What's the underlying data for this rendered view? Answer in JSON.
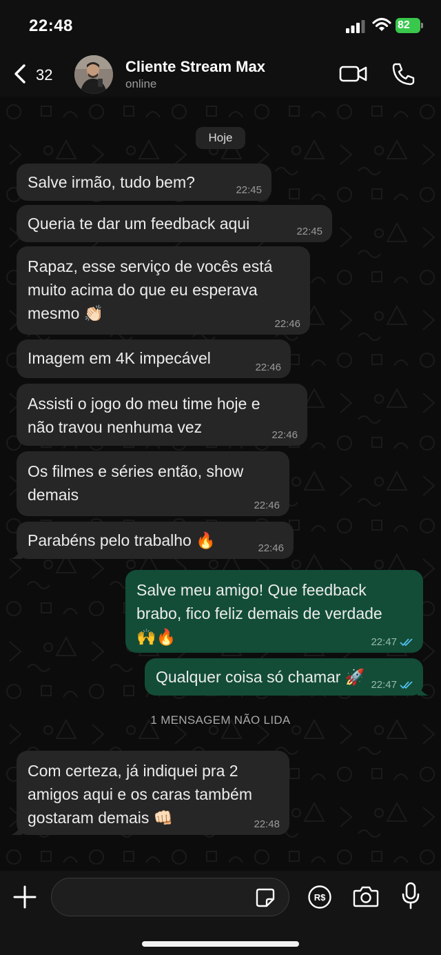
{
  "status_bar": {
    "time": "22:48",
    "battery": "82"
  },
  "header": {
    "back_count": "32",
    "contact_name": "Cliente Stream Max",
    "contact_status": "online"
  },
  "date_label": "Hoje",
  "messages": [
    {
      "direction": "in",
      "text": "Salve irmão, tudo bem?",
      "time": "22:45"
    },
    {
      "direction": "in",
      "text": "Queria te dar um feedback aqui",
      "time": "22:45"
    },
    {
      "direction": "in",
      "text": "Rapaz, esse serviço de vocês está\nmuito acima do que eu esperava\nmesmo 👏🏻",
      "time": "22:46"
    },
    {
      "direction": "in",
      "text": "Imagem em 4K impecável",
      "time": "22:46"
    },
    {
      "direction": "in",
      "text": "Assisti o jogo do meu time hoje e\nnão travou nenhuma vez",
      "time": "22:46"
    },
    {
      "direction": "in",
      "text": "Os filmes e séries então, show\ndemais",
      "time": "22:46"
    },
    {
      "direction": "in",
      "text": "Parabéns pelo trabalho 🔥",
      "time": "22:46"
    },
    {
      "direction": "out",
      "text": "Salve meu amigo! Que feedback\nbrabo, fico feliz demais de verdade\n🙌🔥",
      "time": "22:47",
      "read": true
    },
    {
      "direction": "out",
      "text": "Qualquer coisa só chamar 🚀",
      "time": "22:47",
      "read": true
    },
    {
      "direction": "in",
      "text": "Com certeza, já indiquei pra 2\namigos aqui e os caras também\ngostaram demais 👊🏻",
      "time": "22:48"
    }
  ],
  "unread_divider": "1 MENSAGEM NÃO LIDA",
  "input": {
    "placeholder": "",
    "value": ""
  },
  "colors": {
    "incoming_bubble": "#262626",
    "outgoing_bubble": "#134d37",
    "read_ticks": "#53bdeb",
    "battery": "#39c84c"
  },
  "icons": [
    "back-chevron-icon",
    "signal-icon",
    "wifi-icon",
    "battery-icon",
    "video-call-icon",
    "phone-icon",
    "double-check-icon",
    "plus-icon",
    "sticker-icon",
    "payment-icon",
    "camera-icon",
    "mic-icon"
  ]
}
